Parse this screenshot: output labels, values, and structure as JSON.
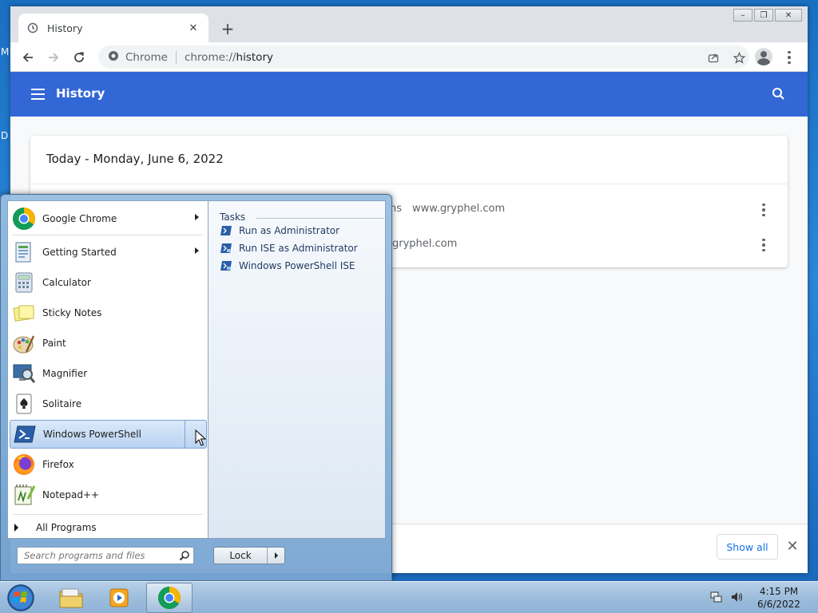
{
  "desktop": {
    "fragment_1": "M",
    "fragment_2": "D"
  },
  "chrome": {
    "tab_title": "History",
    "omnibox_site": "Chrome",
    "omnibox_scheme": "chrome://",
    "omnibox_path": "history",
    "window_controls": {
      "minimize": "–",
      "restore": "❐",
      "close": "✕"
    }
  },
  "history": {
    "header_title": "History",
    "card_heading": "Today - Monday, June 6, 2022",
    "rows": [
      {
        "text_left": "ns",
        "domain": "www.gryphel.com"
      },
      {
        "domain": "gryphel.com"
      }
    ],
    "show_all_label": "Show all"
  },
  "start_menu": {
    "programs": [
      {
        "label": "Google Chrome",
        "icon": "chrome-icon",
        "submenu": true
      },
      {
        "label": "Getting Started",
        "icon": "getting-started-icon",
        "submenu": true
      },
      {
        "label": "Calculator",
        "icon": "calculator-icon",
        "submenu": false
      },
      {
        "label": "Sticky Notes",
        "icon": "sticky-notes-icon",
        "submenu": false
      },
      {
        "label": "Paint",
        "icon": "paint-icon",
        "submenu": false
      },
      {
        "label": "Magnifier",
        "icon": "magnifier-icon",
        "submenu": false
      },
      {
        "label": "Solitaire",
        "icon": "solitaire-icon",
        "submenu": false
      },
      {
        "label": "Windows PowerShell",
        "icon": "powershell-icon",
        "submenu": true,
        "highlighted": true
      },
      {
        "label": "Firefox",
        "icon": "firefox-icon",
        "submenu": false
      },
      {
        "label": "Notepad++",
        "icon": "notepadpp-icon",
        "submenu": false
      }
    ],
    "all_programs_label": "All Programs",
    "tasks_heading": "Tasks",
    "tasks": [
      {
        "label": "Run as Administrator"
      },
      {
        "label": "Run ISE as Administrator"
      },
      {
        "label": "Windows PowerShell ISE"
      }
    ],
    "search_placeholder": "Search programs and files",
    "lock_label": "Lock"
  },
  "taskbar": {
    "time": "4:15 PM",
    "date": "6/6/2022"
  },
  "colors": {
    "chrome_blue": "#3367d6",
    "link_blue": "#1a73e8",
    "desktop_blue": "#2c86d8"
  }
}
